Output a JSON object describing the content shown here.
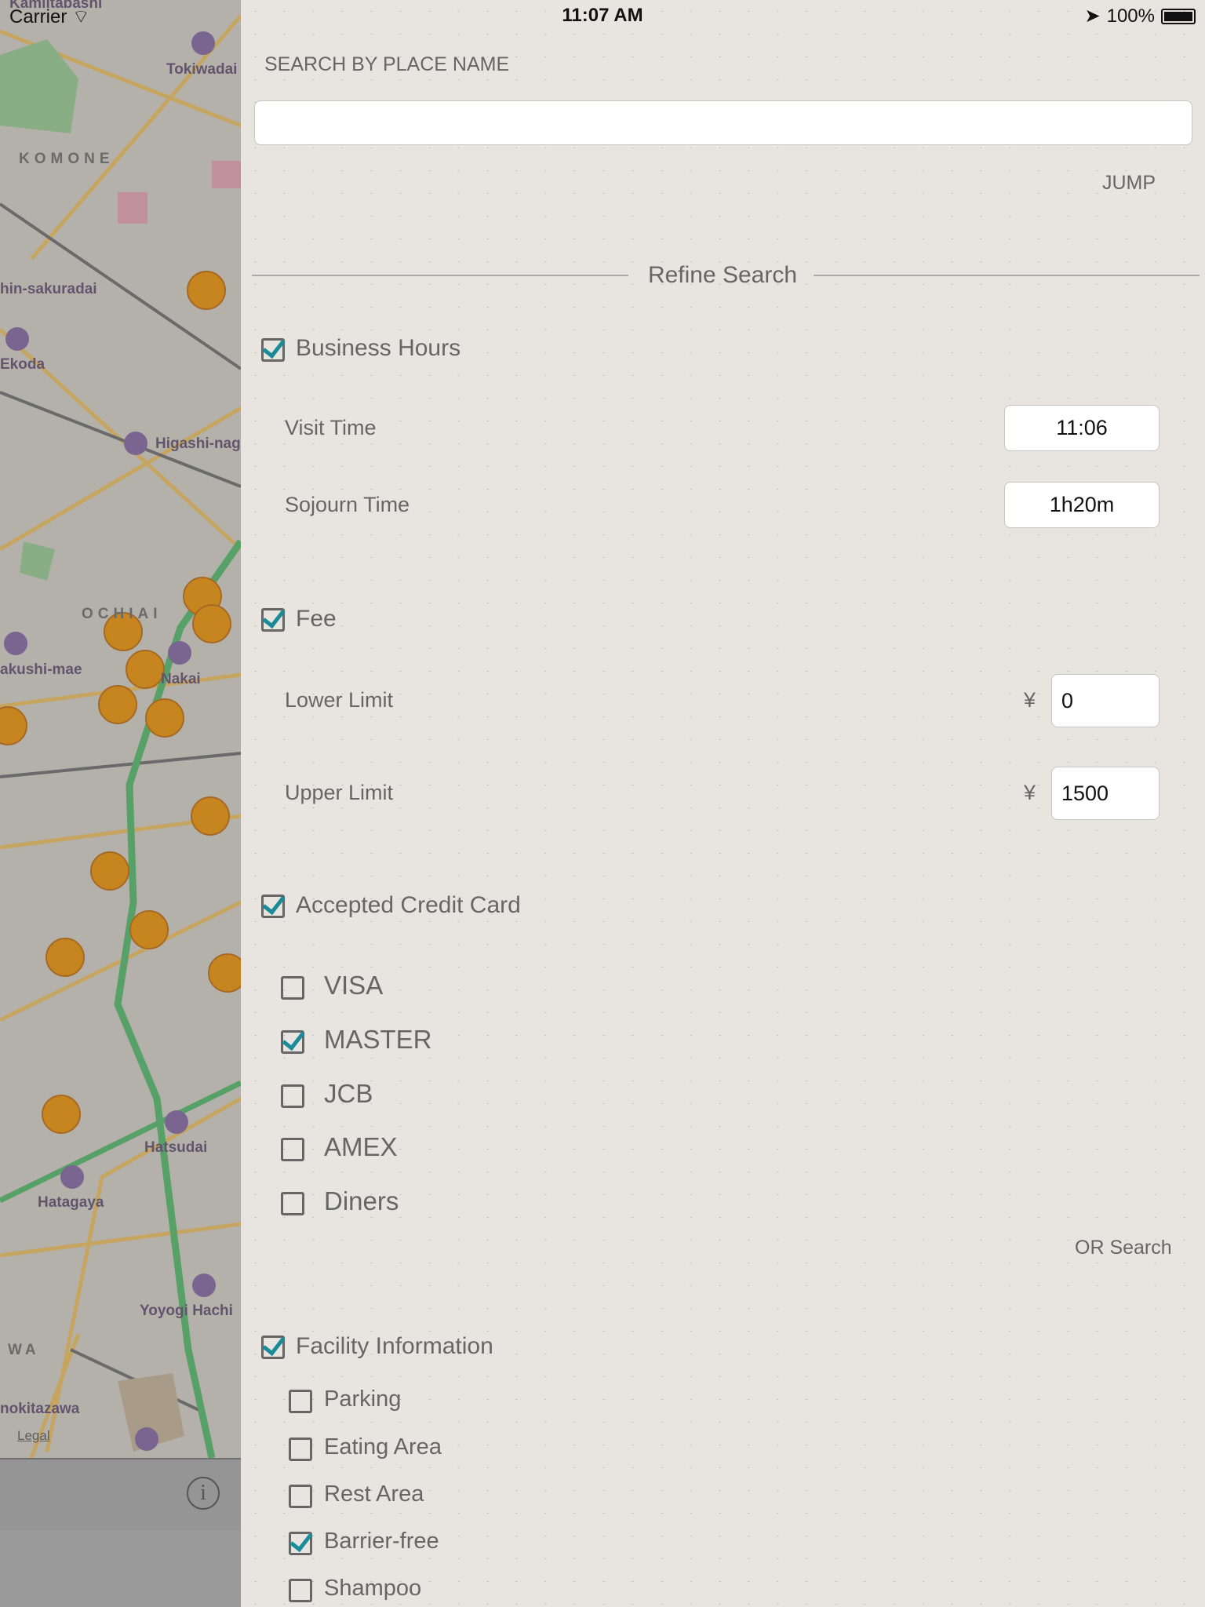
{
  "status_bar": {
    "carrier": "Carrier",
    "time": "11:07 AM",
    "battery": "100%"
  },
  "map": {
    "labels": [
      "Kamiitabashi",
      "Tokiwadai",
      "KOMONE",
      "hin-sakuradai",
      "Ekoda",
      "Higashi-nag",
      "OCHIAI",
      "akushi-mae",
      "Nakai",
      "Hatsudai",
      "Hatagaya",
      "Yoyogi Hachi",
      "WA",
      "nokitazawa"
    ],
    "legal": "Legal",
    "pin_color": "#e08a00",
    "rail_color": "#4caf64"
  },
  "search": {
    "title": "SEARCH BY PLACE NAME",
    "value": "",
    "placeholder": "",
    "jump": "JUMP"
  },
  "refine": {
    "title": "Refine Search"
  },
  "business_hours": {
    "label": "Business Hours",
    "checked": true,
    "visit_time_label": "Visit Time",
    "visit_time": "11:06",
    "sojourn_label": "Sojourn Time",
    "sojourn": "1h20m"
  },
  "fee": {
    "label": "Fee",
    "checked": true,
    "currency": "¥",
    "lower_label": "Lower Limit",
    "lower": "0",
    "upper_label": "Upper Limit",
    "upper": "1500"
  },
  "credit": {
    "label": "Accepted Credit Card",
    "checked": true,
    "cards": [
      {
        "label": "VISA",
        "checked": false
      },
      {
        "label": "MASTER",
        "checked": true
      },
      {
        "label": "JCB",
        "checked": false
      },
      {
        "label": "AMEX",
        "checked": false
      },
      {
        "label": "Diners",
        "checked": false
      }
    ],
    "mode": "OR Search"
  },
  "facility": {
    "label": "Facility Information",
    "checked": true,
    "items": [
      {
        "label": "Parking",
        "checked": false
      },
      {
        "label": "Eating Area",
        "checked": false
      },
      {
        "label": "Rest Area",
        "checked": false
      },
      {
        "label": "Barrier-free",
        "checked": true
      },
      {
        "label": "Shampoo",
        "checked": false
      }
    ]
  },
  "accent": "#1a8c99"
}
